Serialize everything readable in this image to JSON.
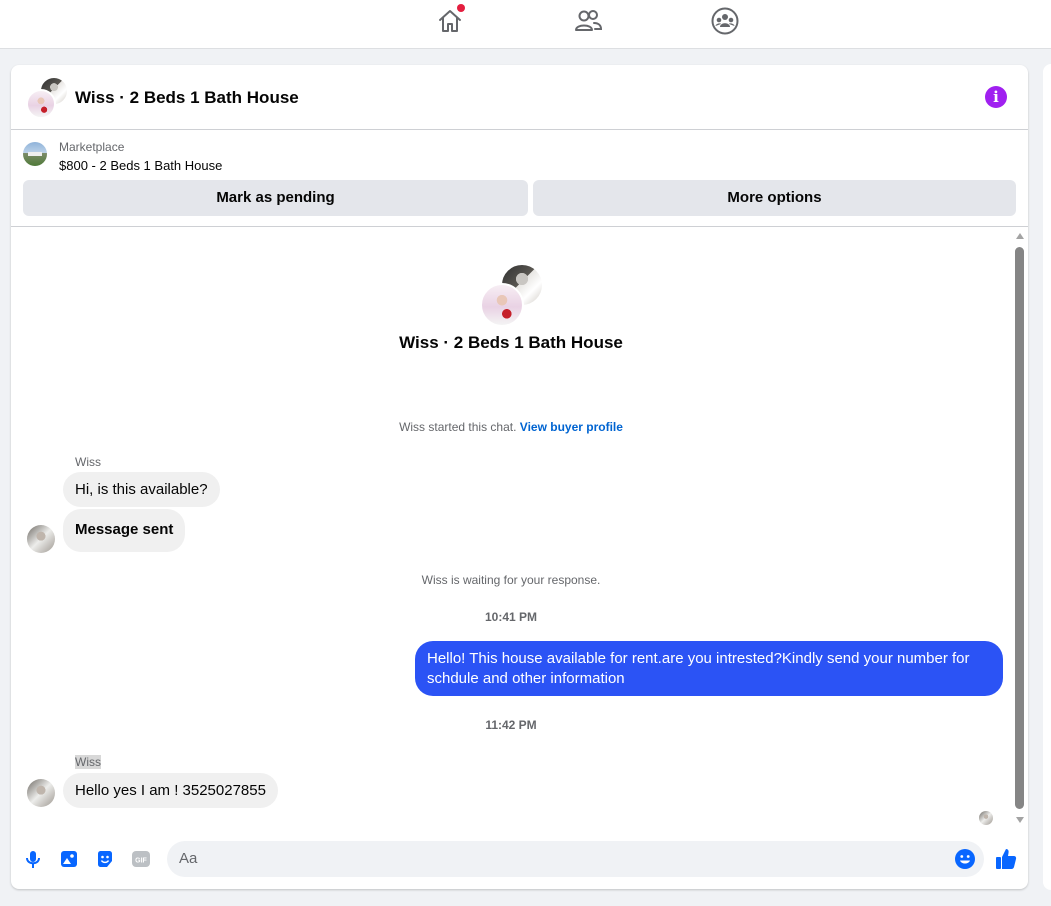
{
  "nav": {
    "icons": [
      "home-icon",
      "friends-icon",
      "groups-icon"
    ],
    "home_has_notification": true
  },
  "header": {
    "title": "Wiss · 2 Beds 1 Bath House",
    "info_icon": "i"
  },
  "marketplace": {
    "label": "Marketplace",
    "item": "$800 - 2 Beds 1 Bath House",
    "mark_pending_label": "Mark as pending",
    "more_options_label": "More options"
  },
  "conversation": {
    "title": "Wiss · 2 Beds 1 Bath House",
    "started_text": "Wiss started this chat.",
    "view_profile_link": "View buyer profile",
    "waiting_text": "Wiss is waiting for your response.",
    "messages": [
      {
        "sender": "Wiss",
        "text": "Hi, is this available?",
        "direction": "incoming"
      },
      {
        "text": "Message sent",
        "direction": "incoming"
      },
      {
        "time": "10:41 PM"
      },
      {
        "text": "Hello! This house available for rent.are you intrested?Kindly send your number for schdule and other information",
        "direction": "outgoing"
      },
      {
        "time": "11:42 PM"
      },
      {
        "sender": "Wiss",
        "text": "Hello yes I am ! 3525027855",
        "direction": "incoming"
      }
    ]
  },
  "composer": {
    "placeholder": "Aa",
    "icons": [
      "microphone-icon",
      "photo-icon",
      "sticker-icon",
      "gif-icon",
      "emoji-icon",
      "thumbs-up-icon"
    ],
    "gif_label": "GIF"
  },
  "colors": {
    "accent": "#0866ff",
    "outgoing_bubble": "#2b53f5",
    "incoming_bubble": "#f0f0f0",
    "info": "#a020f0",
    "notification": "#e41e3f"
  }
}
